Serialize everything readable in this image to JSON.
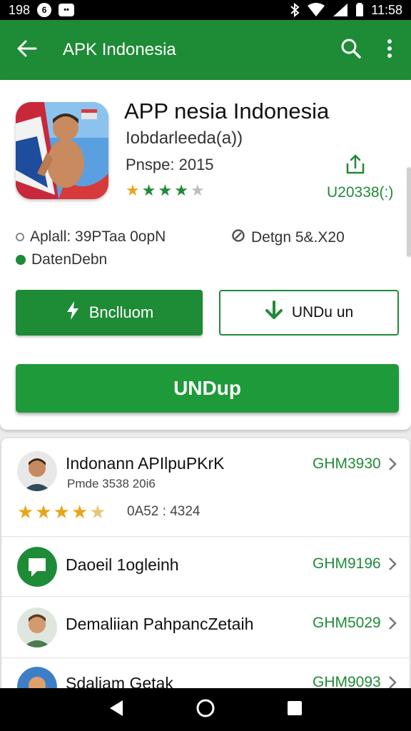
{
  "status_bar": {
    "time_left": "198",
    "time_right": "11:58"
  },
  "app_bar": {
    "title": "APK Indonesia"
  },
  "app": {
    "name": "APP nesia Indonesia",
    "subname": "Iobdarleeda(a))",
    "year": "Pnspe: 2015",
    "rating_stars": 4,
    "download_count": "U20338(:)",
    "info_apk": "Aplall: 39PTaa 0opN",
    "info_design": "Detgn 5&.X20",
    "info_status": "DatenDebn"
  },
  "buttons": {
    "primary": "Bnclluom",
    "outline": "UNDu un",
    "big": "UNDup"
  },
  "list": {
    "items": [
      {
        "title": "Indonann APIlpuPKrK",
        "subtitle": "Pmde 3538 20i6",
        "rating_text": "0A52 : 4324",
        "price": "GHM3930"
      },
      {
        "title": "Daoeil 1ogleinh",
        "price": "GHM9196"
      },
      {
        "title": "Demaliian PahpancZetaih",
        "price": "GHM5029"
      },
      {
        "title": "Sdaliam Getak",
        "price": "GHM9093"
      }
    ]
  },
  "colors": {
    "brand_green": "#1e8b36",
    "star_gold": "#e8a617"
  }
}
